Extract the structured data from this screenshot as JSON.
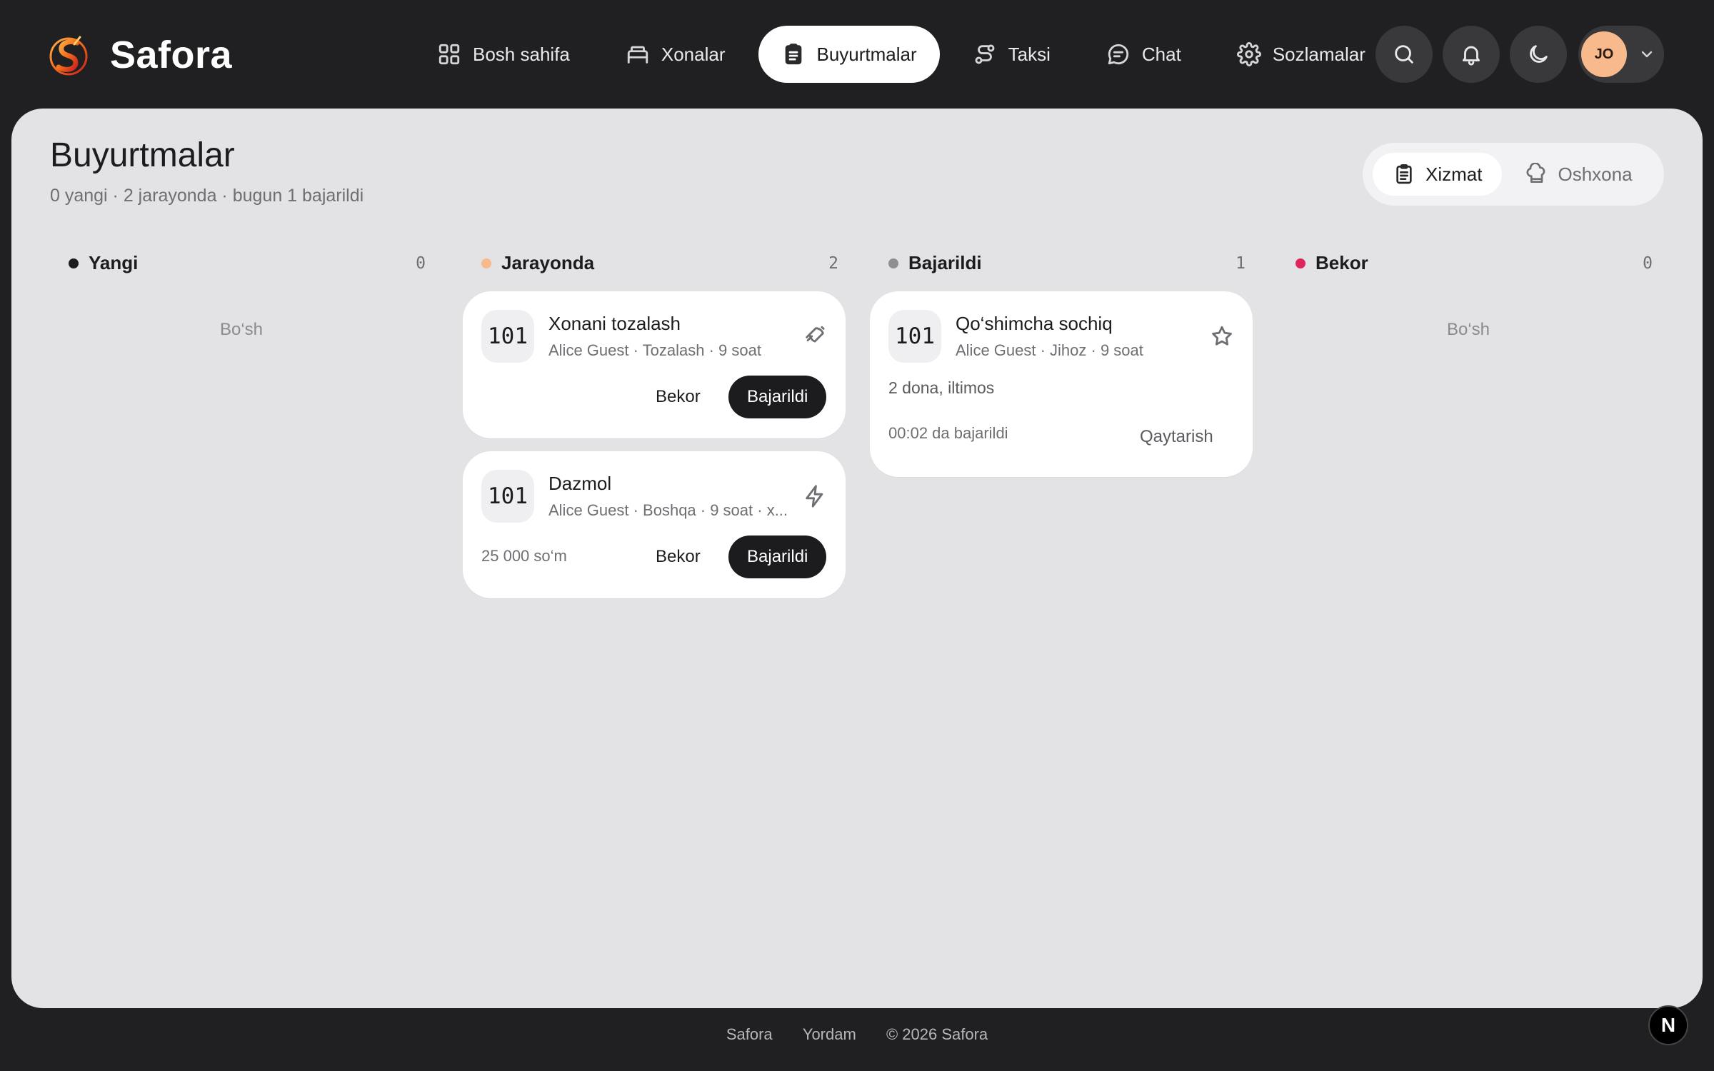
{
  "brand": {
    "name": "Safora"
  },
  "nav": [
    {
      "label": "Bosh sahifa",
      "icon": "grid-icon"
    },
    {
      "label": "Xonalar",
      "icon": "bed-icon"
    },
    {
      "label": "Buyurtmalar",
      "icon": "clipboard-icon",
      "active": true
    },
    {
      "label": "Taksi",
      "icon": "route-icon"
    },
    {
      "label": "Chat",
      "icon": "chat-icon"
    },
    {
      "label": "Sozlamalar",
      "icon": "gear-icon"
    }
  ],
  "user": {
    "initials": "JO"
  },
  "page": {
    "title": "Buyurtmalar",
    "subtitle": "0 yangi · 2 jarayonda · bugun 1 bajarildi"
  },
  "segment": {
    "service": "Xizmat",
    "kitchen": "Oshxona",
    "active": "service"
  },
  "columns": {
    "new": {
      "title": "Yangi",
      "count": "0",
      "empty": "Bo‘sh",
      "dot_color": "#1c1c1e"
    },
    "progress": {
      "title": "Jarayonda",
      "count": "2",
      "dot_color": "#f8b98c"
    },
    "done": {
      "title": "Bajarildi",
      "count": "1",
      "dot_color": "#8e8e93"
    },
    "cancelled": {
      "title": "Bekor",
      "count": "0",
      "empty": "Bo‘sh",
      "dot_color": "#e0245e"
    }
  },
  "cards": {
    "cleaning": {
      "room": "101",
      "title": "Xonani tozalash",
      "meta": "Alice Guest · Tozalash · 9 soat",
      "icon": "broom-icon",
      "cancel": "Bekor",
      "done": "Bajarildi"
    },
    "iron": {
      "room": "101",
      "title": "Dazmol",
      "meta": "Alice Guest · Boshqa · 9 soat · x...",
      "icon": "lightning-icon",
      "price": "25 000 so‘m",
      "cancel": "Bekor",
      "done": "Bajarildi"
    },
    "towel": {
      "room": "101",
      "title": "Qo‘shimcha sochiq",
      "meta": "Alice Guest · Jihoz · 9 soat",
      "icon": "star-icon",
      "note": "2 dona, iltimos",
      "completed": "00:02 da bajarildi",
      "revert": "Qaytarish"
    }
  },
  "footer": {
    "brand": "Safora",
    "help": "Yordam",
    "copyright": "© 2026 Safora"
  },
  "badge": "N"
}
